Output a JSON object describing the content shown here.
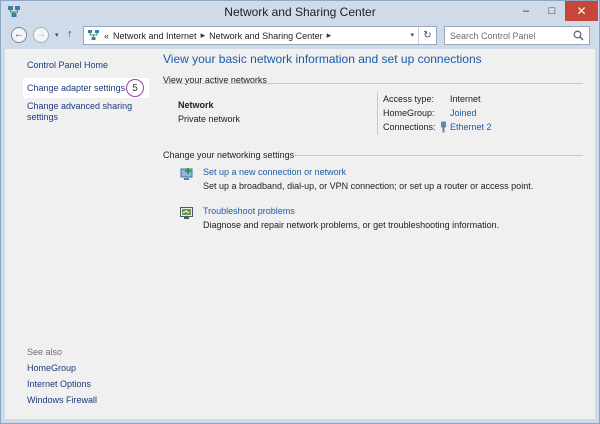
{
  "window": {
    "title": "Network and Sharing Center",
    "minimize_glyph": "–",
    "maximize_glyph": "□",
    "close_glyph": "✕"
  },
  "nav": {
    "back_glyph": "←",
    "forward_glyph": "→",
    "dropdown_glyph": "▾",
    "up_glyph": "↑"
  },
  "address": {
    "overflow": "«",
    "separator": "▸",
    "crumbs": [
      "Network and Internet",
      "Network and Sharing Center"
    ],
    "dropdown_glyph": "▾",
    "refresh_glyph": "↻"
  },
  "search": {
    "placeholder": "Search Control Panel"
  },
  "sidebar": {
    "home": "Control Panel Home",
    "adapter": "Change adapter settings",
    "badge": "5",
    "sharing": "Change advanced sharing settings",
    "see_also_label": "See also",
    "see_also": [
      "HomeGroup",
      "Internet Options",
      "Windows Firewall"
    ]
  },
  "main": {
    "title": "View your basic network information and set up connections",
    "active_head": "View your active networks",
    "network_name": "Network",
    "network_type": "Private network",
    "access_label": "Access type:",
    "access_value": "Internet",
    "homegroup_label": "HomeGroup:",
    "homegroup_value": "Joined",
    "connections_label": "Connections:",
    "connections_value": "Ethernet 2",
    "change_head": "Change your networking settings",
    "tasks": [
      {
        "icon": "new-connection-icon",
        "link": "Set up a new connection or network",
        "desc": "Set up a broadband, dial-up, or VPN connection; or set up a router or access point."
      },
      {
        "icon": "troubleshoot-icon",
        "link": "Troubleshoot problems",
        "desc": "Diagnose and repair network problems, or get troubleshooting information."
      }
    ]
  },
  "colors": {
    "link": "#1c5aa8",
    "nav_link": "#1b3a7a",
    "frame": "#cfdbe8",
    "close": "#c7463a",
    "badge_ring": "#9a3fb0"
  }
}
